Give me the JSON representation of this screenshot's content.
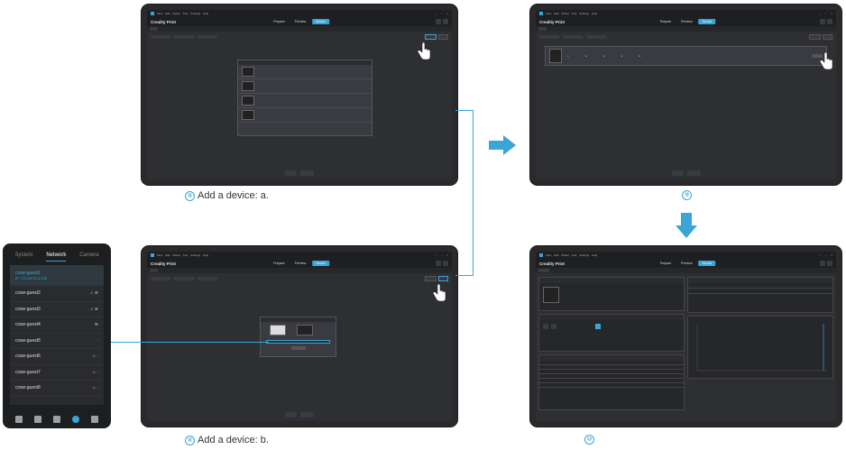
{
  "steps": {
    "step8a": {
      "num": "⑧",
      "text": "Add a device: a."
    },
    "step8b": {
      "num": "⑧",
      "text": "Add a device: b."
    },
    "step9": {
      "num": "⑨"
    },
    "step10": {
      "num": "⑩"
    }
  },
  "app": {
    "name": "Creality Print",
    "menu": [
      "Files",
      "Edit",
      "Model",
      "Tool",
      "Settings",
      "Help"
    ],
    "tabs": [
      "Prepare",
      "Preview",
      "Device"
    ]
  },
  "phone": {
    "tabs": [
      "System",
      "Network",
      "Camera"
    ],
    "networks": [
      {
        "name": "cxsw-guest1",
        "ip": "IP: 172.20.21.4.230"
      },
      {
        "name": "cxsw-guest2"
      },
      {
        "name": "cxsw-guest3"
      },
      {
        "name": "cxsw-guest4"
      },
      {
        "name": "cxsw-guest5"
      },
      {
        "name": "cxsw-guest6"
      },
      {
        "name": "cxsw-guest7"
      },
      {
        "name": "cxsw-guest8"
      }
    ]
  },
  "colors": {
    "accent": "#3aa5d6",
    "window": "#2e2f33",
    "frame": "#2a2a2c"
  }
}
